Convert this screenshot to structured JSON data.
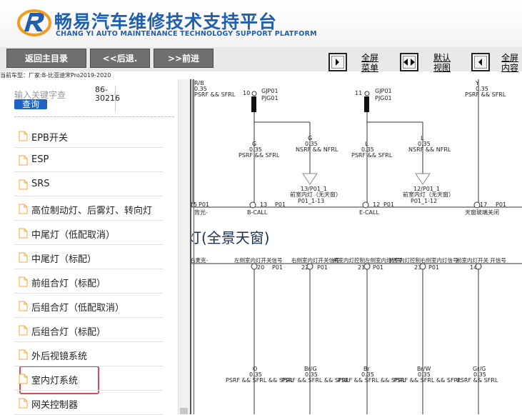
{
  "header": {
    "title_cn": "畅易汽车维修技术支持平台",
    "title_en": "CHANG YI AUTO MAINTENANCE TECHNOLOGY SUPPORT PLATFORM"
  },
  "toolbar": {
    "back_main": "返回主目录",
    "back": "<<后退.",
    "forward": ">>前进",
    "view1": [
      "全屏",
      "菜单"
    ],
    "view2": [
      "默认",
      "视图"
    ],
    "view3": [
      "全屏",
      "内容"
    ]
  },
  "car_info": "当前车型：厂家:B-比亚迪宋Pro2019-2020",
  "search": {
    "placeholder": "输入关键字查",
    "button": "查询",
    "vin": "86-30216"
  },
  "sidebar": {
    "items": [
      "EPB开关",
      "ESP",
      "SRS",
      "高位制动灯、后雾灯、转向灯",
      "中尾灯（低配取消）",
      "中尾灯（标配）",
      "前组合灯（标配）",
      "后组合灯（低配取消）",
      "后组合灯（标配）",
      "外后视镜系统",
      "室内灯系统",
      "网关控制器"
    ],
    "selected": "室内灯系统"
  },
  "diagram": {
    "top": {
      "rb": "R/B",
      "rb_gauge": "0.35",
      "rb_net": "PSRF && SFRL",
      "y": "Y",
      "y_gauge": "0.35",
      "y_net": "PSRF && SFRL",
      "pin10": "10",
      "pin11": "11",
      "gjp": "GJP01",
      "pjg": "PJG01",
      "g": "G",
      "g_gauge": "0.35",
      "g_net": "PSRF && SFRL",
      "g2": "G",
      "g2_gauge": "0.35",
      "g2_net": "NSRF && NFRL",
      "l": "L",
      "l_gauge": "0.35",
      "l_net": "PSRF && SFRL",
      "l2": "L",
      "l2_gauge": "0.35",
      "l2_net": "NSRF && NFRL",
      "conn13": "13/P01_1",
      "conn13_desc": "前室内灯（无天窗）",
      "conn13_pin": "P01_1-13",
      "conn12": "12/P01_1",
      "conn12_desc": "前室内灯（无天窗）",
      "conn12_pin": "P01_1-12",
      "bottom": [
        "15",
        "P01",
        "13",
        "P01",
        "12",
        "P01",
        "17",
        "P01"
      ],
      "bottom_labels": [
        "背光-",
        "B-CALL",
        "E-CALL",
        "天窗玻璃关闭"
      ]
    },
    "section_title": "灯(全景天窗)",
    "signals": [
      "右麦克-",
      "左侧室内灯开关信号",
      "右侧室内灯开关信号",
      "前室内灯控制左侧室内灯信号",
      "前室内灯控制右侧室内灯信号",
      "前室内灯开关 开信号"
    ],
    "pins": [
      "20",
      "P01",
      "22",
      "P01",
      "21",
      "P01",
      "23",
      "P01",
      "14"
    ],
    "wires": [
      {
        "color": "O",
        "gauge": "0.35",
        "net": "PSRF && SFRL && SFRL"
      },
      {
        "color": "Br/G",
        "gauge": "0.35",
        "net": "PSRF && SFRL && SFRL"
      },
      {
        "color": "Br",
        "gauge": "0.35",
        "net": "PSRF && SFRL && SFRL"
      },
      {
        "color": "Br/W",
        "gauge": "0.35",
        "net": "PSRF && SFRL && SFRL"
      },
      {
        "color": "Gr/G",
        "gauge": "0.35",
        "net": "PSRF && SFRL"
      }
    ]
  },
  "colors": {
    "brand_blue": "#1f5fb0",
    "button_gray": "#6f6f6f",
    "highlight_red": "#e0485a",
    "search_blue": "#1b64c4"
  }
}
